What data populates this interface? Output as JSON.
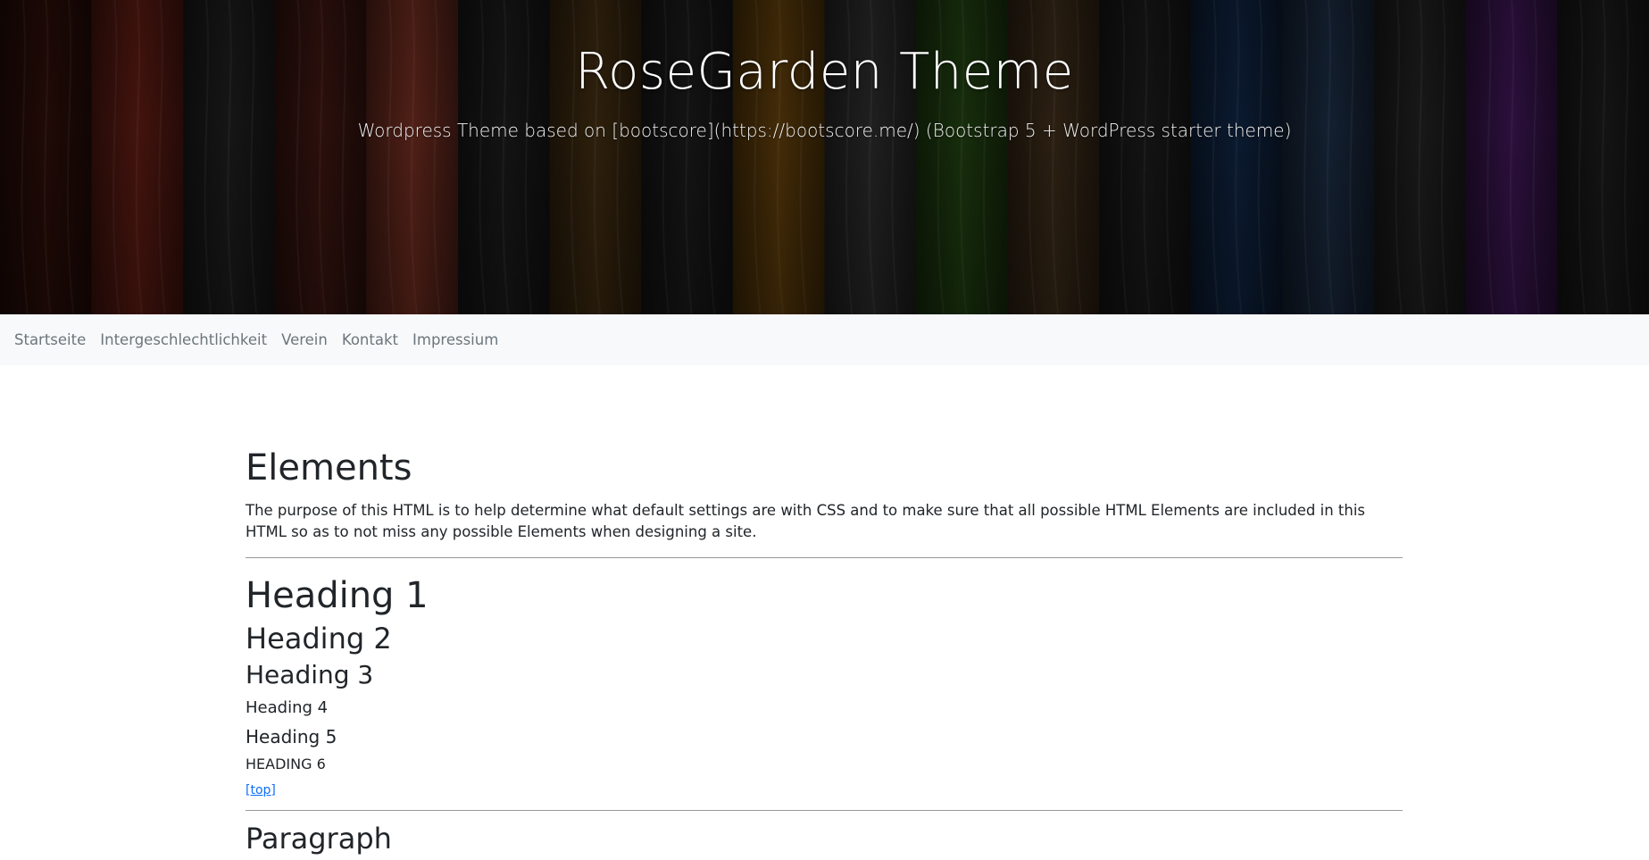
{
  "header": {
    "site_title": "RoseGarden Theme",
    "site_description": "Wordpress Theme based on [bootscore](https://bootscore.me/) (Bootstrap 5 + WordPress starter theme)",
    "plank_colors": [
      "#2a0d08",
      "#5a1a12",
      "#1d1d1d",
      "#3a1510",
      "#6a2a1e",
      "#1a1a1a",
      "#3d2a10",
      "#1a1a1a",
      "#5a3a0a",
      "#2a2a2a",
      "#1f3d10",
      "#3a2a18",
      "#1a1a1a",
      "#0f2340",
      "#1a2a40",
      "#202020",
      "#3a1550",
      "#1a1a1a"
    ]
  },
  "nav": {
    "items": [
      "Startseite",
      "Intergeschlechtlichkeit",
      "Verein",
      "Kontakt",
      "Impressium"
    ]
  },
  "content": {
    "title": "Elements",
    "intro": "The purpose of this HTML is to help determine what default settings are with CSS and to make sure that all possible HTML Elements are included in this HTML so as to not miss any possible Elements when designing a site.",
    "headings": [
      "Heading 1",
      "Heading 2",
      "Heading 3",
      "Heading 4",
      "Heading 5",
      "Heading 6"
    ],
    "top_link": "[top]",
    "next_section_title": "Paragraph"
  },
  "colors": {
    "link": "#0d6efd",
    "nav_text": "#6c757d",
    "nav_bg": "#f8f9fa",
    "text": "#212529"
  }
}
